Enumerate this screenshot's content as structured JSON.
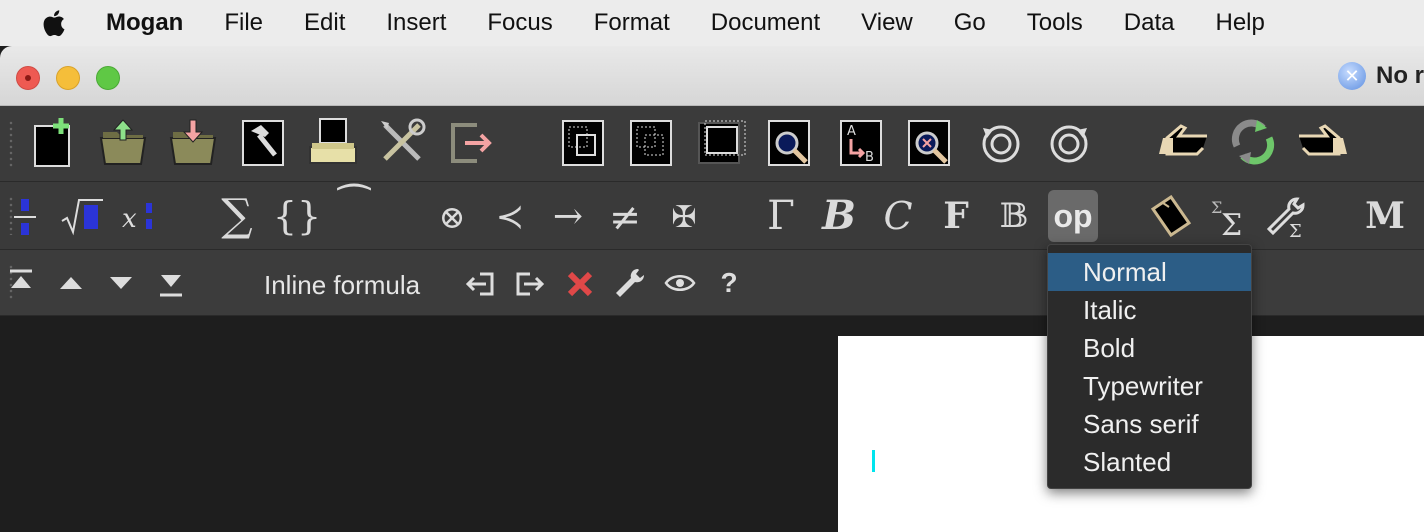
{
  "menubar": {
    "app_name": "Mogan",
    "items": [
      "File",
      "Edit",
      "Insert",
      "Focus",
      "Format",
      "Document",
      "View",
      "Go",
      "Tools",
      "Data",
      "Help"
    ]
  },
  "window": {
    "title": "No r"
  },
  "toolbar1": {
    "icons": [
      "new-document-icon",
      "open-folder-icon",
      "save-folder-icon",
      "build-hammer-icon",
      "print-icon",
      "tools-icon",
      "export-icon",
      "copy-icon",
      "cut-icon",
      "paste-icon",
      "search-icon",
      "replace-icon",
      "spell-check-icon",
      "undo-icon",
      "redo-icon",
      "back-pointer-icon",
      "recycle-icon",
      "forward-pointer-icon"
    ]
  },
  "toolbar2": {
    "fraction_symbol": "÷",
    "sum_symbol": "∑",
    "braces_symbol": "{}",
    "tilde_symbol": "⁀",
    "otimes_symbol": "⊗",
    "prec_symbol": "≺",
    "arrow_symbol": "→",
    "neq_symbol": "≠",
    "cross_symbol": "✠",
    "gamma_symbol": "Γ",
    "bold_symbol": "B",
    "cal_symbol": "C",
    "frak_symbol": "F",
    "bb_symbol": "𝔹",
    "op_label": "op",
    "macro_symbol": "M"
  },
  "toolbar3": {
    "mode_label": "Inline formula",
    "help_symbol": "?"
  },
  "dropdown": {
    "selected_index": 0,
    "items": [
      "Normal",
      "Italic",
      "Bold",
      "Typewriter",
      "Sans serif",
      "Slanted"
    ]
  },
  "colors": {
    "selection": "#2c5d86",
    "cursor": "#00e5ee",
    "delete_red": "#e04848"
  }
}
